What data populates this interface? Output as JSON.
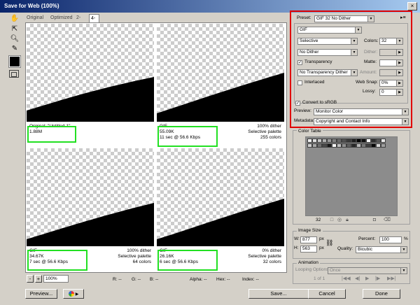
{
  "window": {
    "title": "Save for Web (100%)"
  },
  "tabs": [
    {
      "label": "Original"
    },
    {
      "label": "Optimized"
    },
    {
      "label": "2-Up"
    },
    {
      "label": "4-Up"
    }
  ],
  "panes": [
    {
      "l1": "Original: \"Untitled-1\"",
      "l2": "1.88M",
      "l3": "",
      "r1": "",
      "r2": "",
      "r3": ""
    },
    {
      "l1": "GIF",
      "l2": "55.09K",
      "l3": "11 sec @ 56.6 Kbps",
      "r1": "100% dither",
      "r2": "Selective palette",
      "r3": "255 colors"
    },
    {
      "l1": "GIF",
      "l2": "34.67K",
      "l3": "7 sec @ 56.6 Kbps",
      "r1": "100% dither",
      "r2": "Selective palette",
      "r3": "64 colors"
    },
    {
      "l1": "GIF",
      "l2": "26.16K",
      "l3": "6 sec @ 56.6 Kbps",
      "r1": "0% dither",
      "r2": "Selective palette",
      "r3": "32 colors"
    }
  ],
  "status": {
    "zoom": "100%",
    "r": "R: --",
    "g": "G: --",
    "b": "B: --",
    "alpha": "Alpha: --",
    "hex": "Hex: --",
    "index": "Index: --"
  },
  "buttons": {
    "preview": "Preview...",
    "save": "Save...",
    "cancel": "Cancel",
    "done": "Done"
  },
  "settings": {
    "preset_label": "Preset:",
    "preset_value": "GIF 32 No Dither",
    "format": "GIF",
    "reduction": "Selective",
    "colors_label": "Colors:",
    "colors_value": "32",
    "dither_algo": "No Dither",
    "dither_label": "Dither:",
    "transparency_label": "Transparency",
    "matte_label": "Matte:",
    "trans_dither": "No Transparency Dither",
    "amount_label": "Amount:",
    "interlaced_label": "Interlaced",
    "websnap_label": "Web Snap:",
    "websnap_value": "0%",
    "lossy_label": "Lossy:",
    "lossy_value": "0",
    "convert_label": "Convert to sRGB",
    "preview_label": "Preview:",
    "preview_value": "Monitor Color",
    "metadata_label": "Metadata:",
    "metadata_value": "Copyright and Contact Info"
  },
  "color_table": {
    "title": "Color Table",
    "count": "32"
  },
  "image_size": {
    "title": "Image Size",
    "w_label": "W:",
    "w_value": "877",
    "h_label": "H:",
    "h_value": "563",
    "unit": "px",
    "percent_label": "Percent:",
    "percent_value": "100",
    "pct": "%",
    "quality_label": "Quality:",
    "quality_value": "Bicubic"
  },
  "animation": {
    "title": "Animation",
    "looping_label": "Looping Options:",
    "looping_value": "Once",
    "frame": "1 of 1"
  },
  "colors": {
    "highlight_green": "#22e022",
    "highlight_red": "#e00000"
  }
}
